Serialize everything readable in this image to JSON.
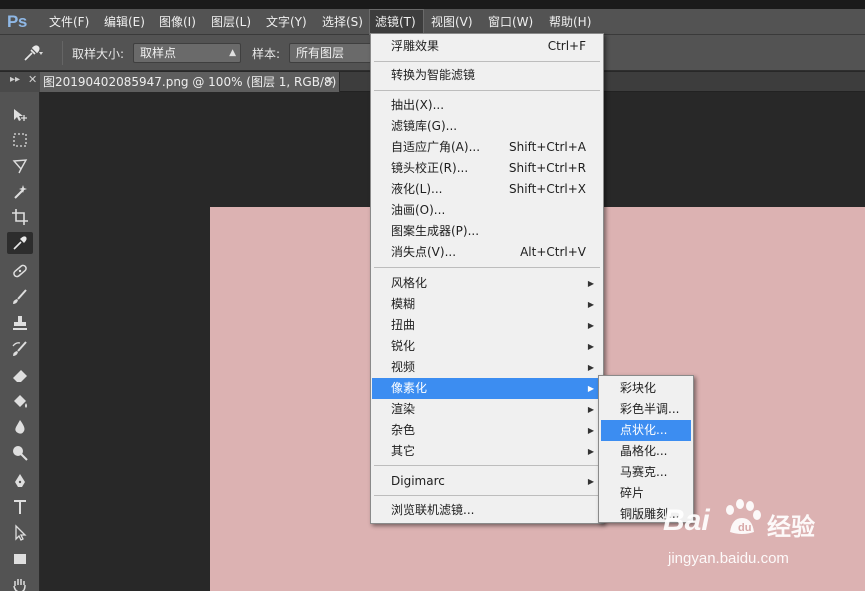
{
  "app": {
    "logo": "Ps"
  },
  "menubar": {
    "items": [
      "文件(F)",
      "编辑(E)",
      "图像(I)",
      "图层(L)",
      "文字(Y)",
      "选择(S)",
      "滤镜(T)",
      "视图(V)",
      "窗口(W)",
      "帮助(H)"
    ],
    "active": "滤镜(T)"
  },
  "options": {
    "sample_size_label": "取样大小:",
    "sample_size_value": "取样点",
    "sample_label": "样本:",
    "sample_value": "所有图层"
  },
  "document_tab": {
    "title": "图20190402085947.png @ 100% (图层 1, RGB/8) *"
  },
  "filter_menu": {
    "items": [
      {
        "label": "浮雕效果",
        "shortcut": "Ctrl+F"
      },
      {
        "label": "转换为智能滤镜"
      },
      {
        "label": "抽出(X)..."
      },
      {
        "label": "滤镜库(G)..."
      },
      {
        "label": "自适应广角(A)...",
        "shortcut": "Shift+Ctrl+A"
      },
      {
        "label": "镜头校正(R)...",
        "shortcut": "Shift+Ctrl+R"
      },
      {
        "label": "液化(L)...",
        "shortcut": "Shift+Ctrl+X"
      },
      {
        "label": "油画(O)..."
      },
      {
        "label": "图案生成器(P)..."
      },
      {
        "label": "消失点(V)...",
        "shortcut": "Alt+Ctrl+V"
      },
      {
        "label": "风格化"
      },
      {
        "label": "模糊"
      },
      {
        "label": "扭曲"
      },
      {
        "label": "锐化"
      },
      {
        "label": "视频"
      },
      {
        "label": "像素化"
      },
      {
        "label": "渲染"
      },
      {
        "label": "杂色"
      },
      {
        "label": "其它"
      },
      {
        "label": "Digimarc"
      },
      {
        "label": "浏览联机滤镜..."
      }
    ],
    "highlighted": "像素化"
  },
  "pixelate_submenu": {
    "items": [
      "彩块化",
      "彩色半调...",
      "点状化...",
      "晶格化...",
      "马赛克...",
      "碎片",
      "铜版雕刻..."
    ],
    "highlighted": "点状化..."
  },
  "watermark": {
    "brand": "Bai",
    "brand_cn": "经验",
    "url": "jingyan.baidu.com"
  },
  "colors": {
    "menu_highlight": "#3c8df1",
    "image_fill": "#dcb2b2",
    "ui_panel": "#535353",
    "workspace": "#282828"
  }
}
